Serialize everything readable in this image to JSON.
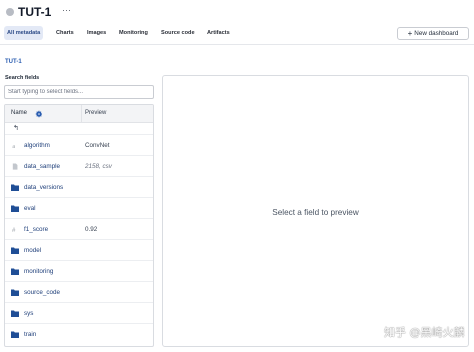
{
  "header": {
    "title": "TUT-1",
    "more_label": "···"
  },
  "tabs": [
    {
      "label": "All metadata",
      "active": true
    },
    {
      "label": "Charts",
      "active": false
    },
    {
      "label": "Images",
      "active": false
    },
    {
      "label": "Monitoring",
      "active": false
    },
    {
      "label": "Source code",
      "active": false
    },
    {
      "label": "Artifacts",
      "active": false
    }
  ],
  "toolbar": {
    "new_dashboard_label": "New dashboard"
  },
  "run_link": "TUT-1",
  "search": {
    "label": "Search fields",
    "placeholder": "Start typing to select fields..."
  },
  "table": {
    "header_name": "Name",
    "header_preview": "Preview",
    "up_label": "↰",
    "rows": [
      {
        "name": "algorithm",
        "type": "string",
        "preview": "ConvNet",
        "preview_italic": false
      },
      {
        "name": "data_sample",
        "type": "file",
        "preview": "2158, csv",
        "preview_italic": true
      },
      {
        "name": "data_versions",
        "type": "folder",
        "preview": "",
        "preview_italic": false
      },
      {
        "name": "eval",
        "type": "folder",
        "preview": "",
        "preview_italic": false
      },
      {
        "name": "f1_score",
        "type": "number",
        "preview": "0.92",
        "preview_italic": false
      },
      {
        "name": "model",
        "type": "folder",
        "preview": "",
        "preview_italic": false
      },
      {
        "name": "monitoring",
        "type": "folder",
        "preview": "",
        "preview_italic": false
      },
      {
        "name": "source_code",
        "type": "folder",
        "preview": "",
        "preview_italic": false
      },
      {
        "name": "sys",
        "type": "folder",
        "preview": "",
        "preview_italic": false
      },
      {
        "name": "train",
        "type": "folder",
        "preview": "",
        "preview_italic": false
      }
    ]
  },
  "preview": {
    "empty_message": "Select a field to preview"
  },
  "watermark": "知乎 @黑崎火麟",
  "colors": {
    "accent": "#2a5db0",
    "folder": "#1f4e96",
    "active_tab_bg": "#e3e9f6",
    "status_dot": "#b8bcc4"
  }
}
